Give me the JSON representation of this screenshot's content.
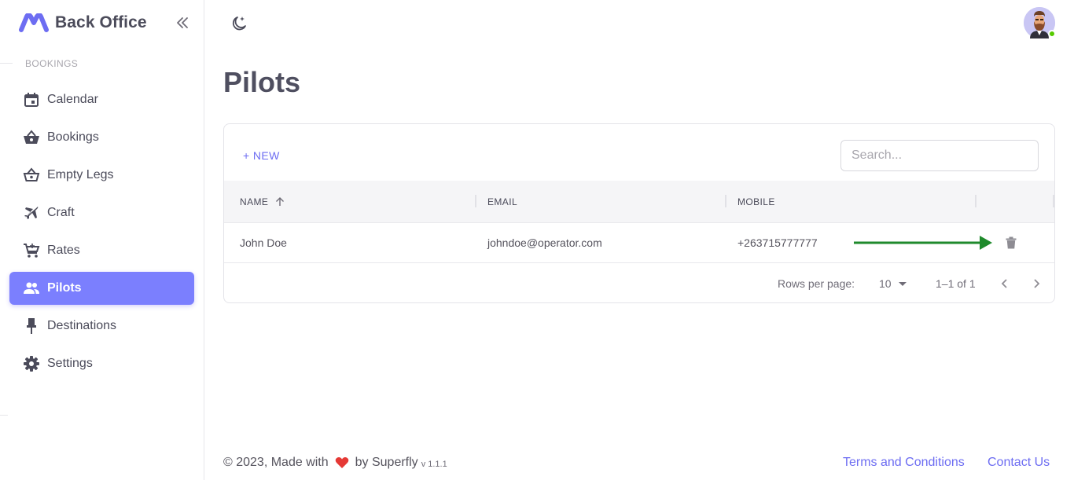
{
  "brand": {
    "title": "Back Office"
  },
  "sidebar": {
    "section_label": "BOOKINGS",
    "items": [
      {
        "label": "Calendar",
        "icon": "calendar-icon"
      },
      {
        "label": "Bookings",
        "icon": "basket-icon"
      },
      {
        "label": "Empty Legs",
        "icon": "basket-outline-icon"
      },
      {
        "label": "Craft",
        "icon": "airplane-icon"
      },
      {
        "label": "Rates",
        "icon": "cart-icon"
      },
      {
        "label": "Pilots",
        "icon": "people-icon",
        "active": true
      },
      {
        "label": "Destinations",
        "icon": "pin-icon"
      },
      {
        "label": "Settings",
        "icon": "gear-icon"
      }
    ]
  },
  "main": {
    "title": "Pilots",
    "new_label": "+ NEW",
    "search_placeholder": "Search...",
    "columns": [
      "NAME",
      "EMAIL",
      "MOBILE"
    ],
    "rows": [
      {
        "name": "John Doe",
        "email": "johndoe@operator.com",
        "mobile": "+263715777777"
      }
    ],
    "pagination": {
      "rows_label": "Rows per page:",
      "rows_value": "10",
      "range": "1–1 of 1"
    }
  },
  "footer": {
    "made_prefix": "© 2023, Made with",
    "made_suffix": "by Superfly",
    "version": "v 1.1.1",
    "terms": "Terms and Conditions",
    "contact": "Contact Us"
  },
  "colors": {
    "accent": "#7b7ffe",
    "link": "#6d6df2",
    "arrow": "#1f8a2c",
    "heart": "#e53935",
    "online": "#56ca00"
  }
}
